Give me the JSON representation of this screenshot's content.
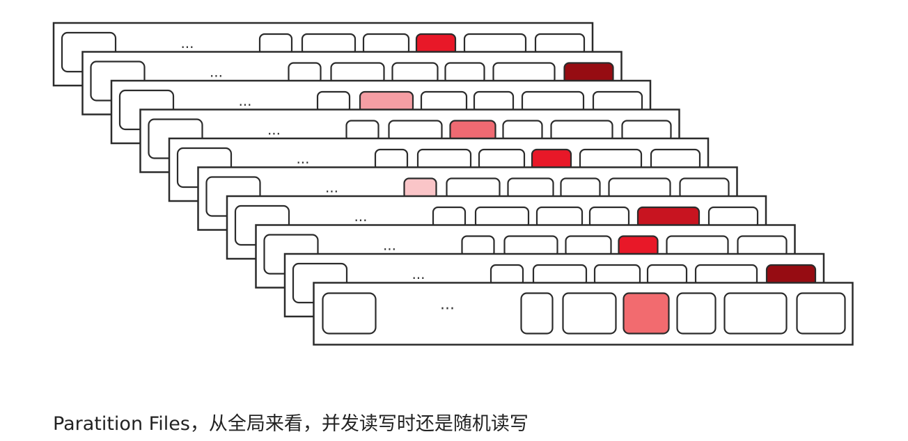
{
  "diagram": {
    "ellipsis": "...",
    "colors": {
      "stroke": "#2b2b2b",
      "empty": "#ffffff",
      "red": "#e81828",
      "dark_red": "#960c12",
      "light_pink": "#f59ea4",
      "medium_pink": "#ef6a72",
      "pale_pink": "#fac5c8",
      "crimson": "#c81420",
      "salmon": "#f26b6f"
    },
    "files": [
      {
        "highlight": 3,
        "color": "red"
      },
      {
        "highlight": 5,
        "color": "dark_red"
      },
      {
        "highlight": 1,
        "color": "light_pink"
      },
      {
        "highlight": 2,
        "color": "medium_pink"
      },
      {
        "highlight": 3,
        "color": "red"
      },
      {
        "highlight": 0,
        "color": "pale_pink"
      },
      {
        "highlight": 4,
        "color": "crimson"
      },
      {
        "highlight": 3,
        "color": "red"
      },
      {
        "highlight": 5,
        "color": "dark_red"
      },
      {
        "highlight": 2,
        "color": "salmon"
      }
    ]
  },
  "caption": {
    "text": "Paratition Files，从全局来看，并发读写时还是随机读写"
  }
}
